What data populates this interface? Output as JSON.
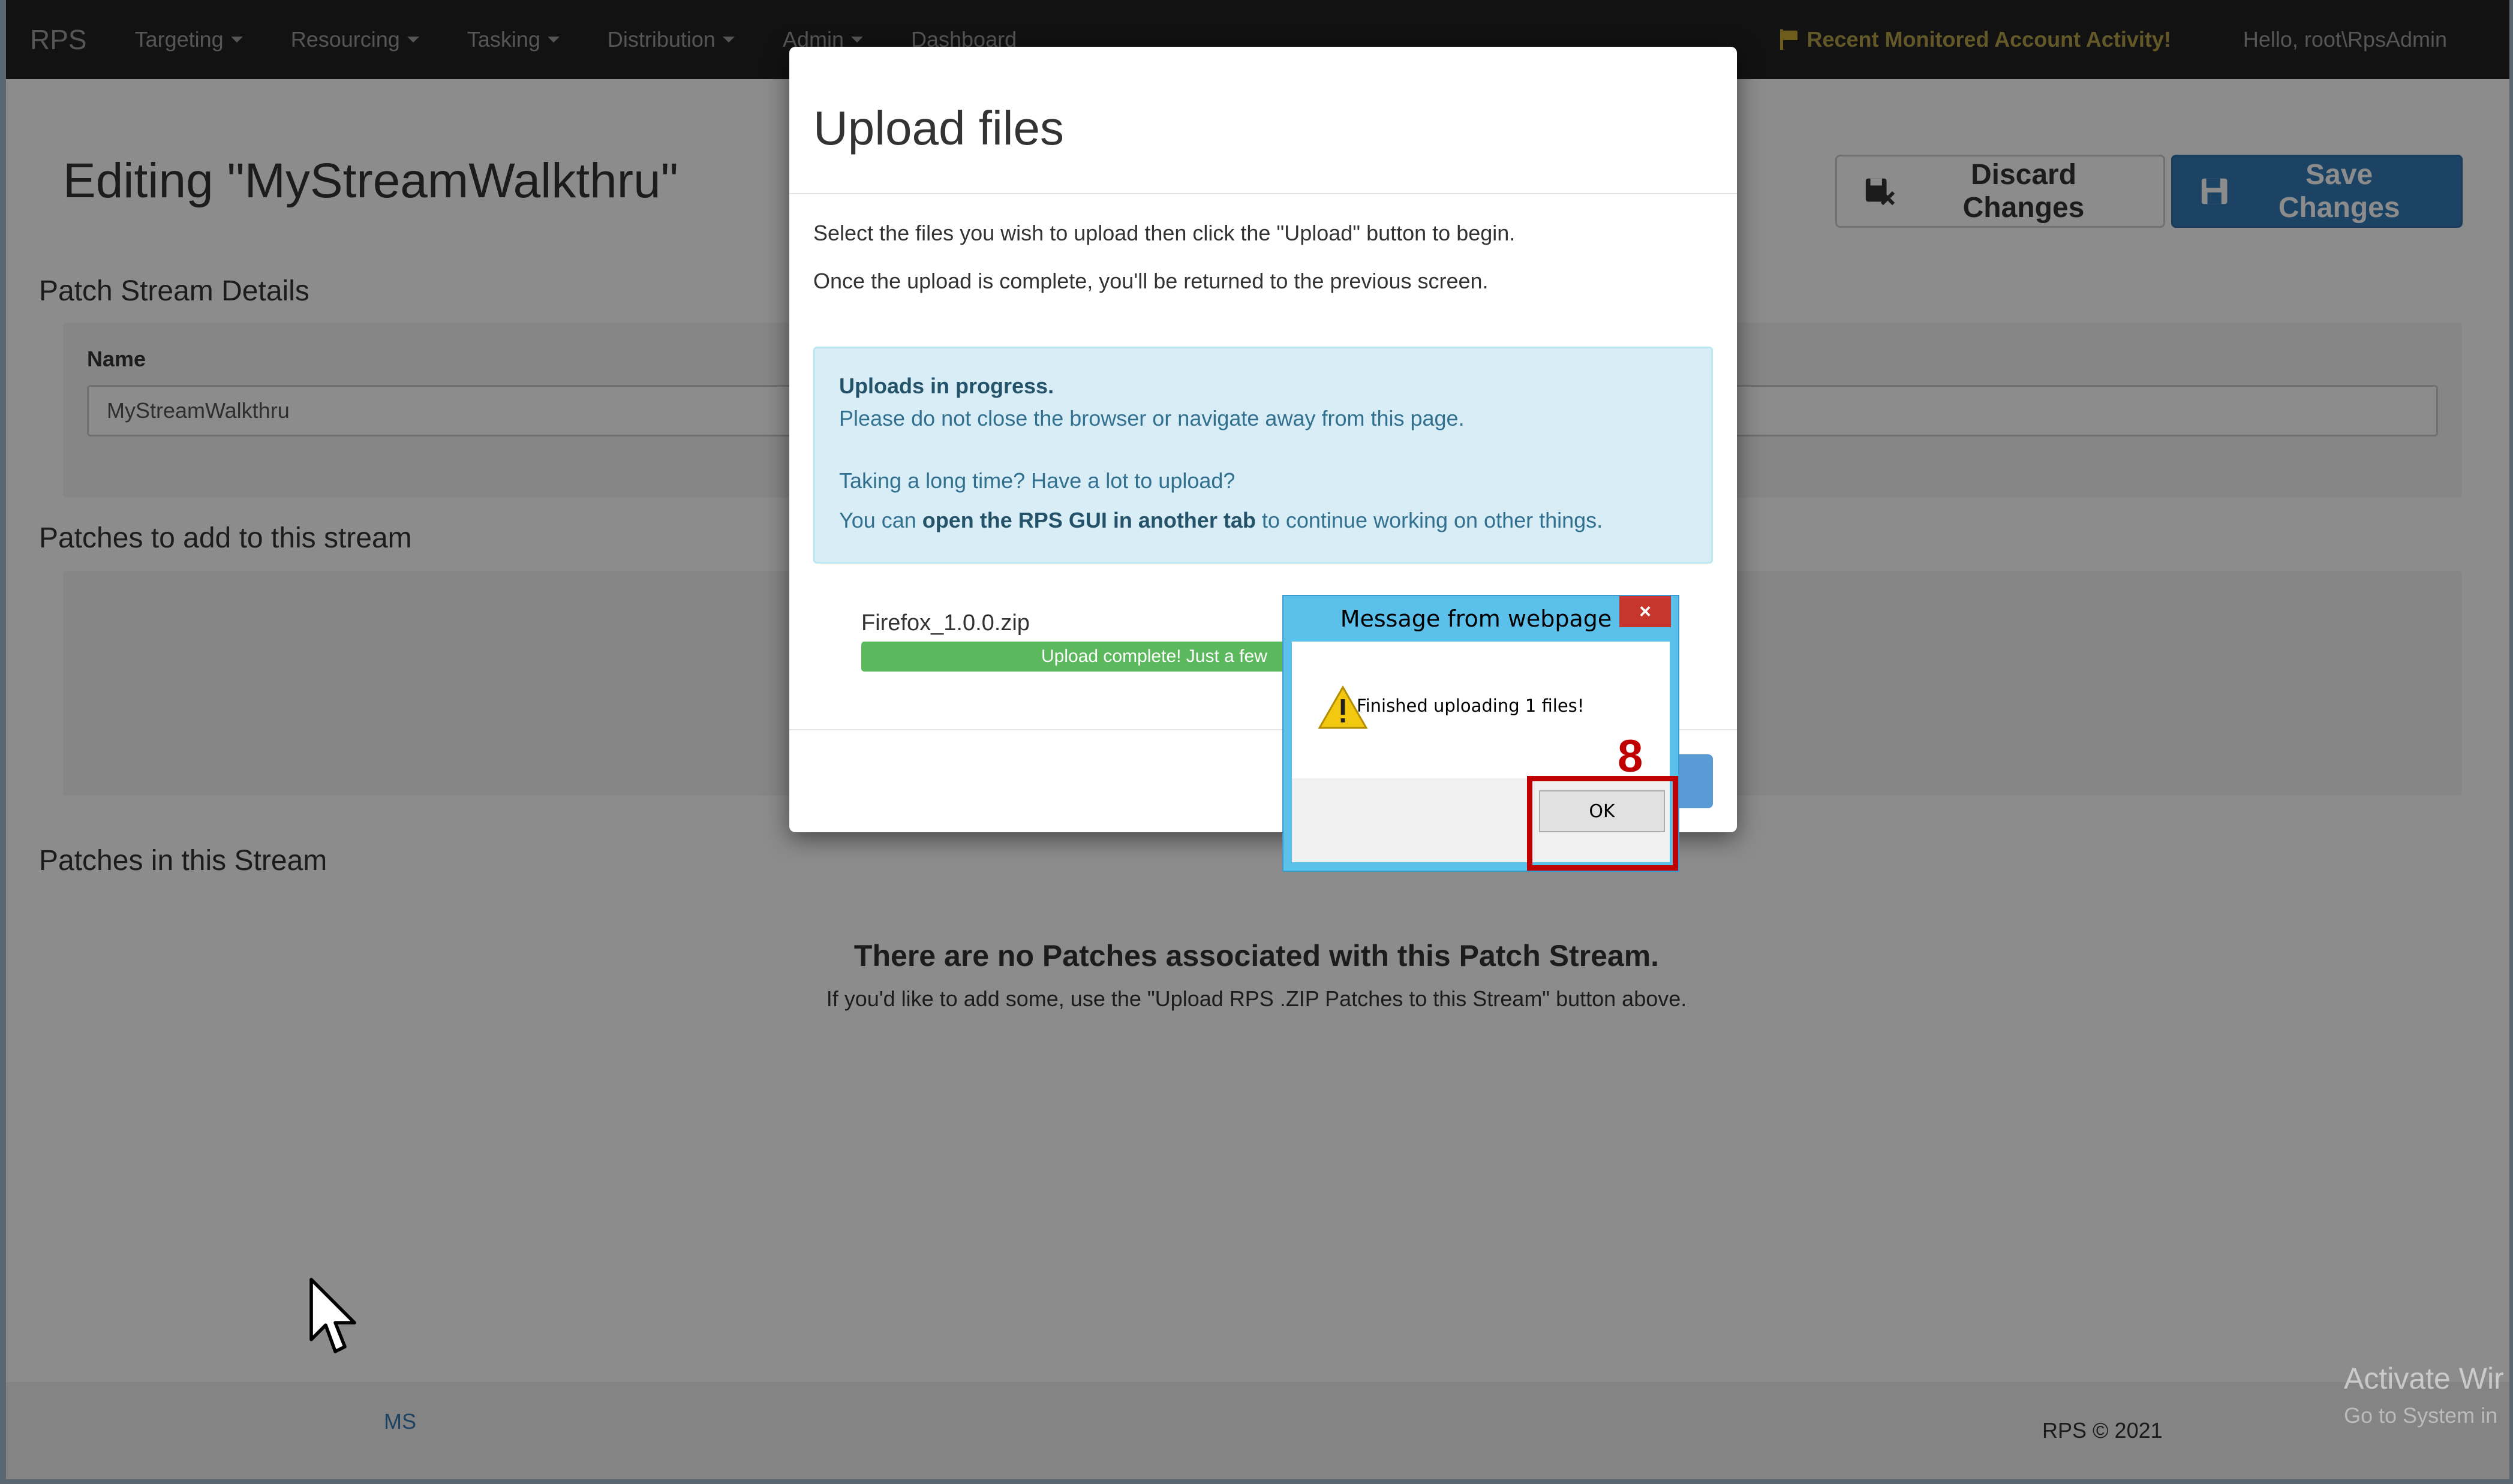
{
  "navbar": {
    "brand": "RPS",
    "menus": [
      "Targeting",
      "Resourcing",
      "Tasking",
      "Distribution",
      "Admin"
    ],
    "dashboard": "Dashboard",
    "activity_link": "Recent Monitored Account Activity!",
    "greeting": "Hello, root\\RpsAdmin",
    "icons": {
      "activity": "flag-icon"
    }
  },
  "page": {
    "title": "Editing \"MyStreamWalkthru\"",
    "discard_label": "Discard Changes",
    "save_label": "Save Changes",
    "details_heading": "Patch Stream Details",
    "name_label": "Name",
    "name_value": "MyStreamWalkthru",
    "add_heading": "Patches to add to this stream",
    "in_stream_heading": "Patches in this Stream",
    "empty_title": "There are no Patches associated with this Patch Stream.",
    "empty_hint": "If you'd like to add some, use the \"Upload RPS .ZIP Patches to this Stream\" button above."
  },
  "footer": {
    "left": "MS",
    "right": "RPS © 2021",
    "watermark": "Activate Wir",
    "watermark_sub": "Go to System in"
  },
  "upload_modal": {
    "title": "Upload files",
    "instruction_1": "Select the files you wish to upload then click the \"Upload\" button to begin.",
    "instruction_2": "Once the upload is complete, you'll be returned to the previous screen.",
    "info_heading": "Uploads in progress.",
    "info_line": "Please do not close the browser or navigate away from this page.",
    "long_time": "Taking a long time? Have a lot to upload?",
    "tab_prefix": "You can ",
    "tab_link": "open the RPS GUI in another tab",
    "tab_suffix": " to continue working on other things.",
    "file_name": "Firefox_1.0.0.zip",
    "progress_label": "Upload complete! Just a few",
    "progress": 1.0
  },
  "message_box": {
    "title": "Message from webpage",
    "close": "×",
    "message": "Finished uploading 1 files!",
    "ok_label": "OK",
    "icons": {
      "warning": "warning-icon"
    }
  },
  "annotation": {
    "step": "8"
  },
  "colors": {
    "navbar": "#222222",
    "primary": "#337ab7",
    "info_bg": "#d9edf7",
    "success": "#5cb85c",
    "highlight": "#c00000",
    "dialog_frame": "#5bc0ea"
  }
}
